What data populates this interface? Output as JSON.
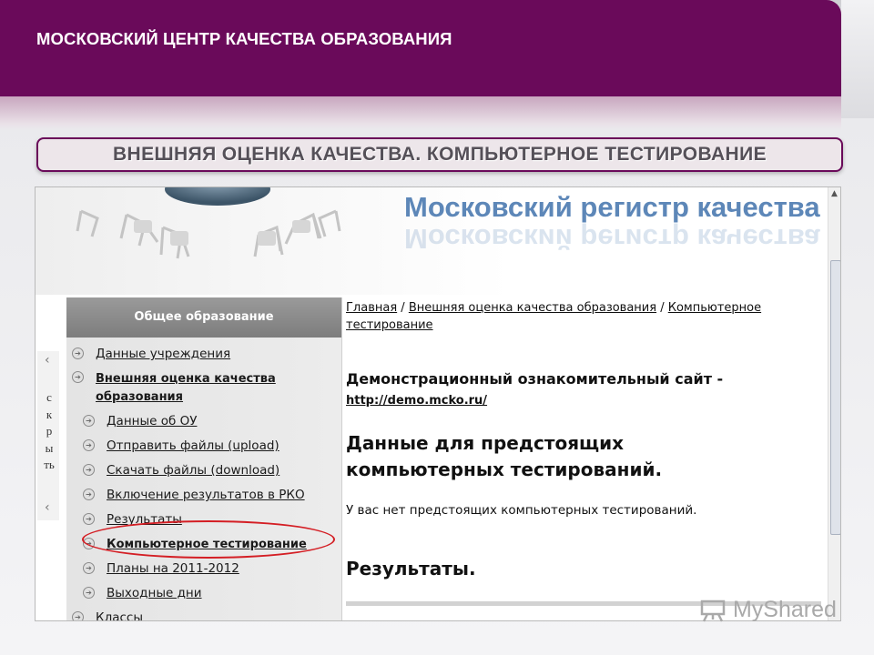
{
  "header": {
    "title": "МОСКОВСКИЙ ЦЕНТР КАЧЕСТВА ОБРАЗОВАНИЯ"
  },
  "banner": {
    "title": "ВНЕШНЯЯ ОЦЕНКА КАЧЕСТВА. КОМПЬЮТЕРНОЕ ТЕСТИРОВАНИЕ"
  },
  "site": {
    "title": "Московский регистр качества о",
    "hide_panel": {
      "label": "скрыть"
    },
    "sidebar": {
      "heading": "Общее образование",
      "items": [
        {
          "label": "Данные учреждения"
        },
        {
          "label": "Внешняя оценка качества образования"
        },
        {
          "label": "Данные об ОУ"
        },
        {
          "label": "Отправить файлы (upload)"
        },
        {
          "label": "Скачать файлы (download)"
        },
        {
          "label": "Включение результатов в РКО"
        },
        {
          "label": "Результаты"
        },
        {
          "label": "Компьютерное тестирование"
        },
        {
          "label": "Планы на 2011-2012"
        },
        {
          "label": "Выходные дни"
        },
        {
          "label": "Классы"
        }
      ]
    },
    "content": {
      "breadcrumb": {
        "home": "Главная",
        "sep": " / ",
        "section": "Внешняя оценка качества образования",
        "current": "Компьютерное тестирование"
      },
      "demo_title": "Демонстрационный ознакомительный сайт -",
      "demo_link": "http://demo.mcko.ru/",
      "upcoming_heading": "Данные для предстоящих компьютерных тестирований.",
      "no_upcoming": "У вас нет предстоящих компьютерных тестирований.",
      "results_heading": "Результаты."
    }
  },
  "watermark": {
    "text": "MyShared"
  },
  "colors": {
    "brand": "#6a0a5a",
    "highlight": "#d41e24",
    "site_title": "#5d87b8"
  }
}
